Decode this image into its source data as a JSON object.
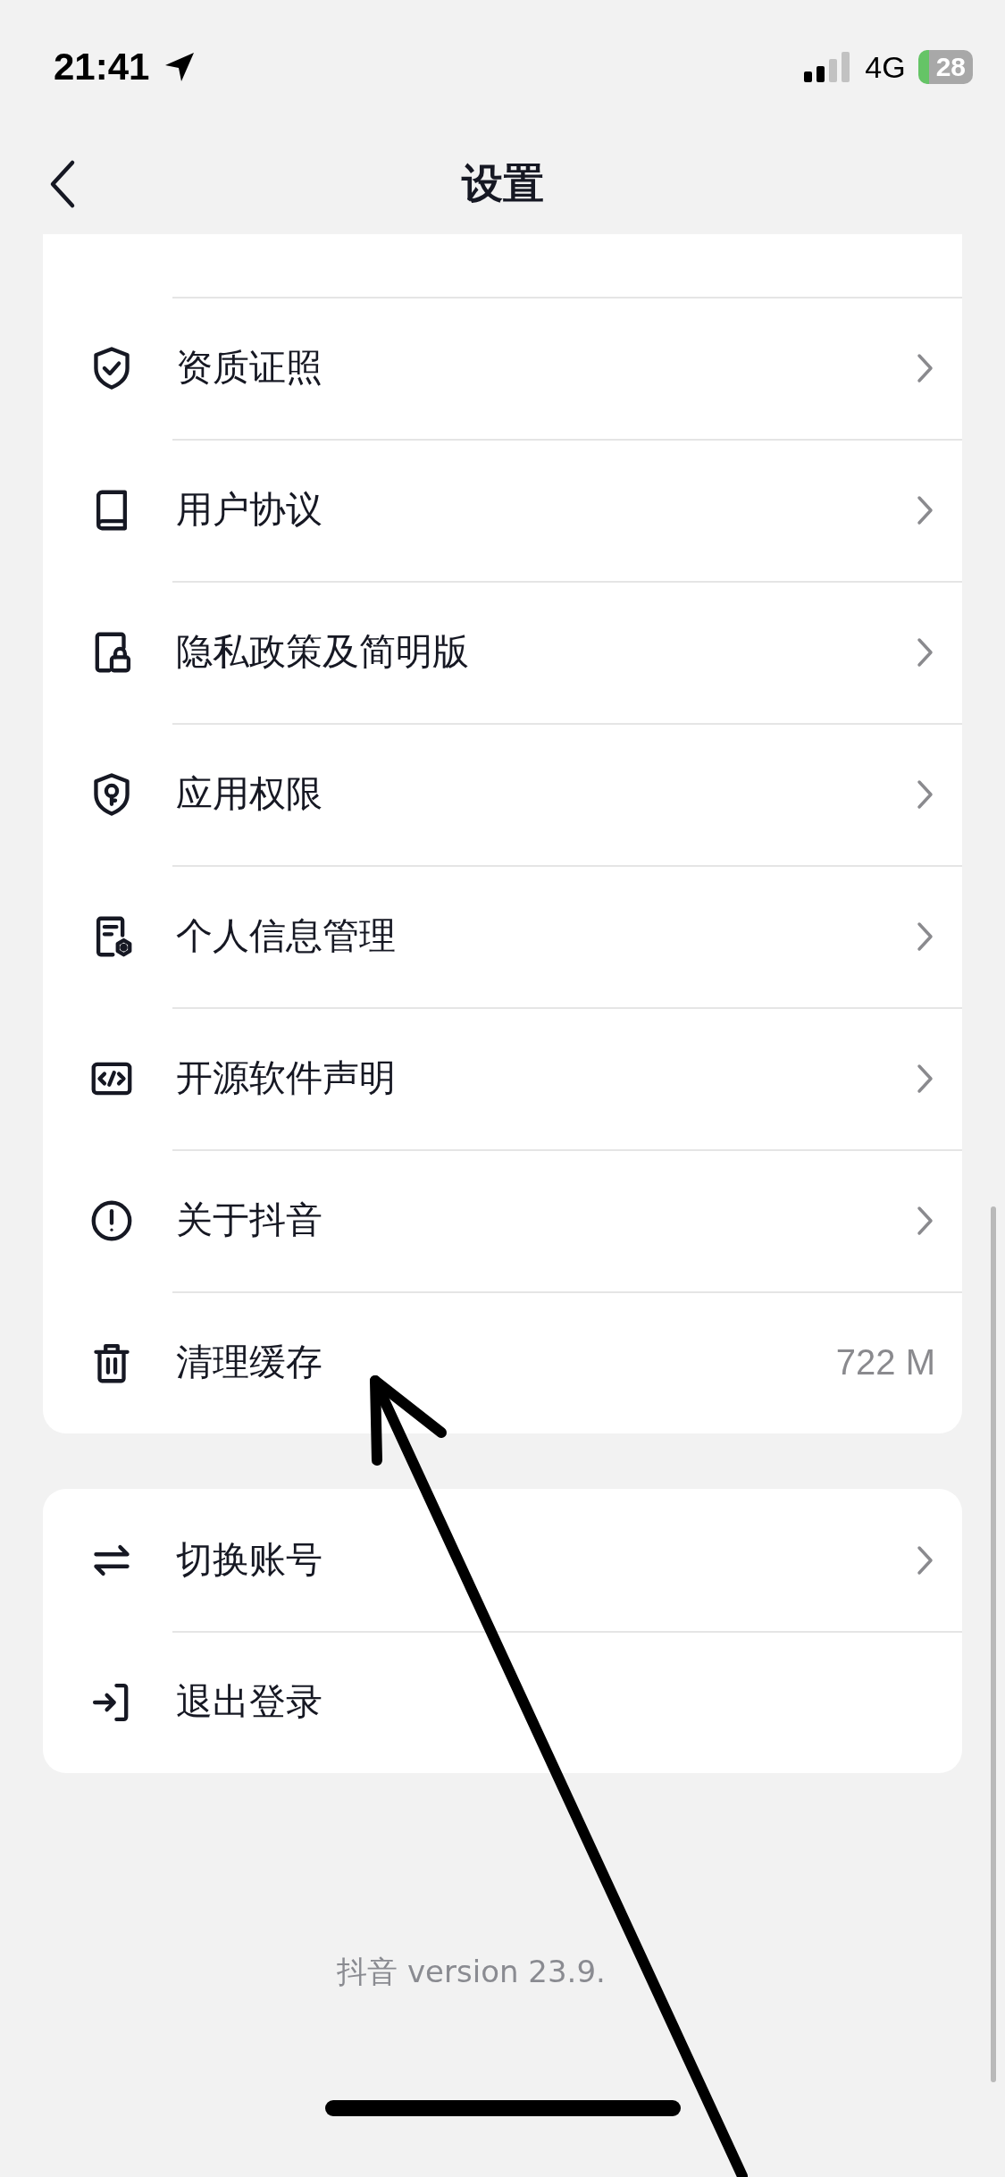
{
  "status_bar": {
    "time": "21:41",
    "network": "4G",
    "battery": "28"
  },
  "header": {
    "title": "设置"
  },
  "groups": [
    {
      "items": [
        {
          "label": "资质证照",
          "kind": "link"
        },
        {
          "label": "用户协议",
          "kind": "link"
        },
        {
          "label": "隐私政策及简明版",
          "kind": "link"
        },
        {
          "label": "应用权限",
          "kind": "link"
        },
        {
          "label": "个人信息管理",
          "kind": "link"
        },
        {
          "label": "开源软件声明",
          "kind": "link"
        },
        {
          "label": "关于抖音",
          "kind": "link"
        },
        {
          "label": "清理缓存",
          "kind": "value",
          "value": "722 M"
        }
      ]
    },
    {
      "items": [
        {
          "label": "切换账号",
          "kind": "link"
        },
        {
          "label": "退出登录",
          "kind": "action"
        }
      ]
    }
  ],
  "footer": {
    "version": "抖音 version 23.9."
  }
}
